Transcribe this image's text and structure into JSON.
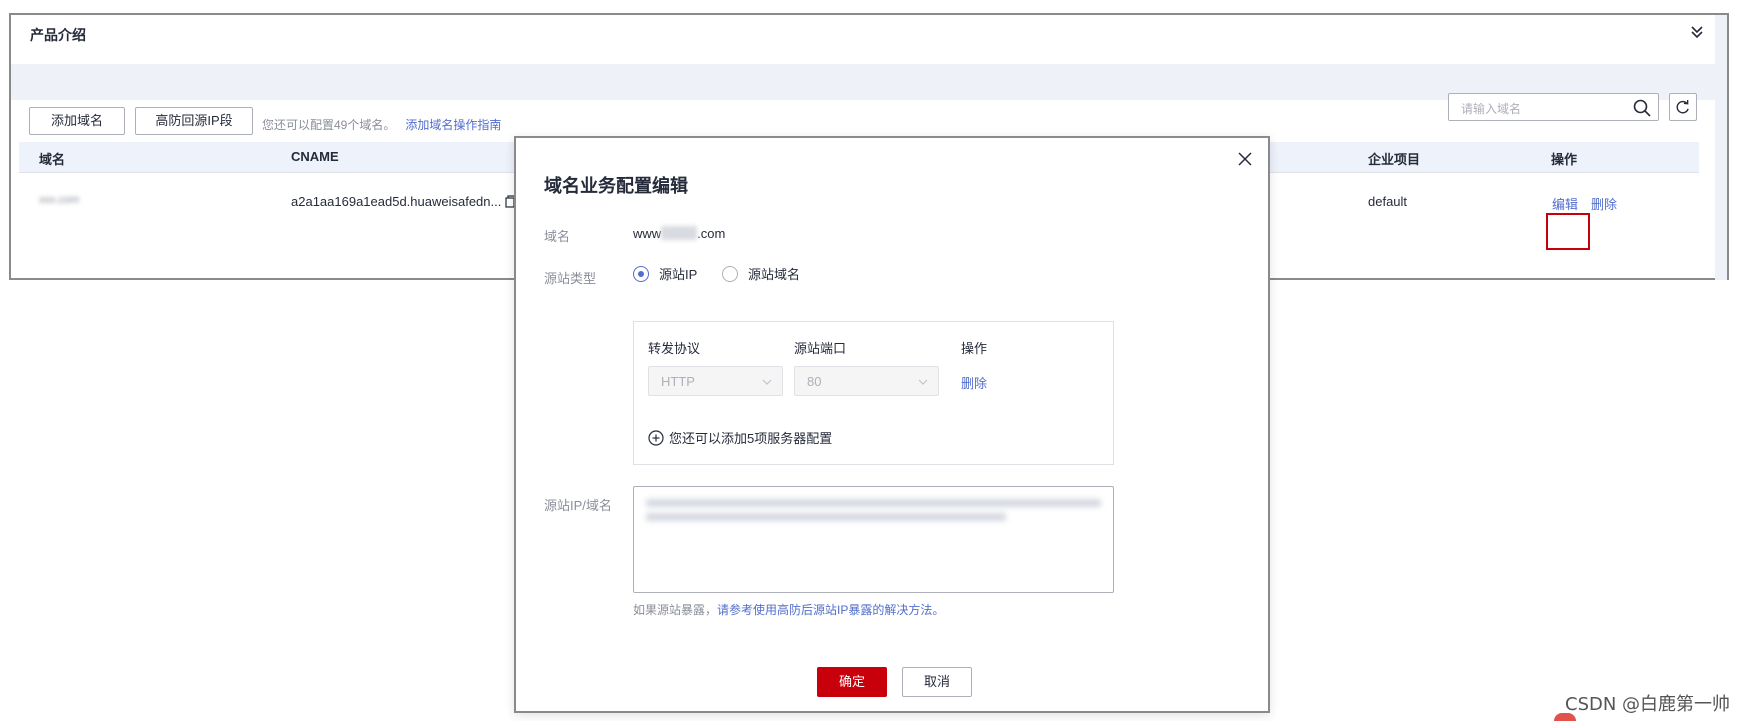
{
  "page": {
    "intro_title": "产品介绍",
    "collapse_icon": "double-chevron-down-icon"
  },
  "toolbar": {
    "add_domain_label": "添加域名",
    "ip_segment_label": "高防回源IP段",
    "remaining_tip": "您还可以配置49个域名。",
    "guide_link": "添加域名操作指南",
    "search_placeholder": "请输入域名",
    "search_icon": "search-icon",
    "refresh_icon": "refresh-icon"
  },
  "table": {
    "headers": {
      "domain": "域名",
      "cname": "CNAME",
      "enterprise_project": "企业项目",
      "operation": "操作"
    },
    "rows": [
      {
        "domain": "xxx.com",
        "cname": "a2a1aa169a1ead5d.huaweisafedn...",
        "enterprise_project": "default",
        "edit": "编辑",
        "delete": "删除"
      }
    ]
  },
  "modal": {
    "title": "域名业务配置编辑",
    "close_icon": "close-icon",
    "domain_label": "域名",
    "domain_prefix": "www",
    "domain_suffix": ".com",
    "origin_type_label": "源站类型",
    "origin_type_options": [
      "源站IP",
      "源站域名"
    ],
    "origin_type_selected": "源站IP",
    "config": {
      "protocol_header": "转发协议",
      "port_header": "源站端口",
      "operation_header": "操作",
      "protocol_value": "HTTP",
      "port_value": "80",
      "delete_label": "删除",
      "add_more_label": "您还可以添加5项服务器配置"
    },
    "origin_address_label": "源站IP/域名",
    "hint_prefix": "如果源站暴露，",
    "hint_link": "请参考使用高防后源站IP暴露的解决方法。",
    "confirm_label": "确定",
    "cancel_label": "取消"
  },
  "watermark": "CSDN @白鹿第一帅",
  "colors": {
    "link_blue": "#526ecc",
    "brand_red": "#c7000b",
    "header_bg": "#eef2fa"
  }
}
